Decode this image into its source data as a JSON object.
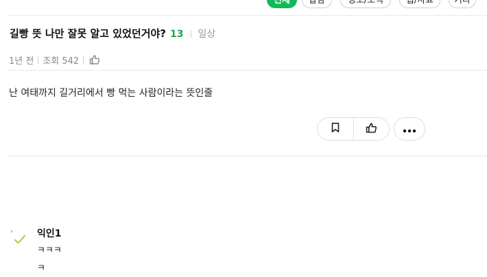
{
  "categories": [
    {
      "label": "전체",
      "active": true
    },
    {
      "label": "잡담",
      "active": false
    },
    {
      "label": "정보/조직",
      "active": false
    },
    {
      "label": "팁/자료",
      "active": false
    },
    {
      "label": "기타",
      "active": false
    }
  ],
  "post": {
    "title": "길빵 뜻 나만 잘못 알고 있었던거야?",
    "comment_count": "13",
    "board": "일상",
    "time_ago": "1년 전",
    "views_label": "조회 542",
    "body": "난 여태까지 길거리에서 빵 먹는 사람이라는 뜻인줄"
  },
  "actions": {
    "bookmark_icon": "bookmark-icon",
    "like_icon": "thumbs-up-icon",
    "more_icon": "more-icon"
  },
  "comments": [
    {
      "author": "익인1",
      "lines": [
        "ㅋㅋㅋ",
        "ㅋ"
      ]
    }
  ],
  "colors": {
    "accent": "#12b95a",
    "comment_count": "#18a84e"
  }
}
